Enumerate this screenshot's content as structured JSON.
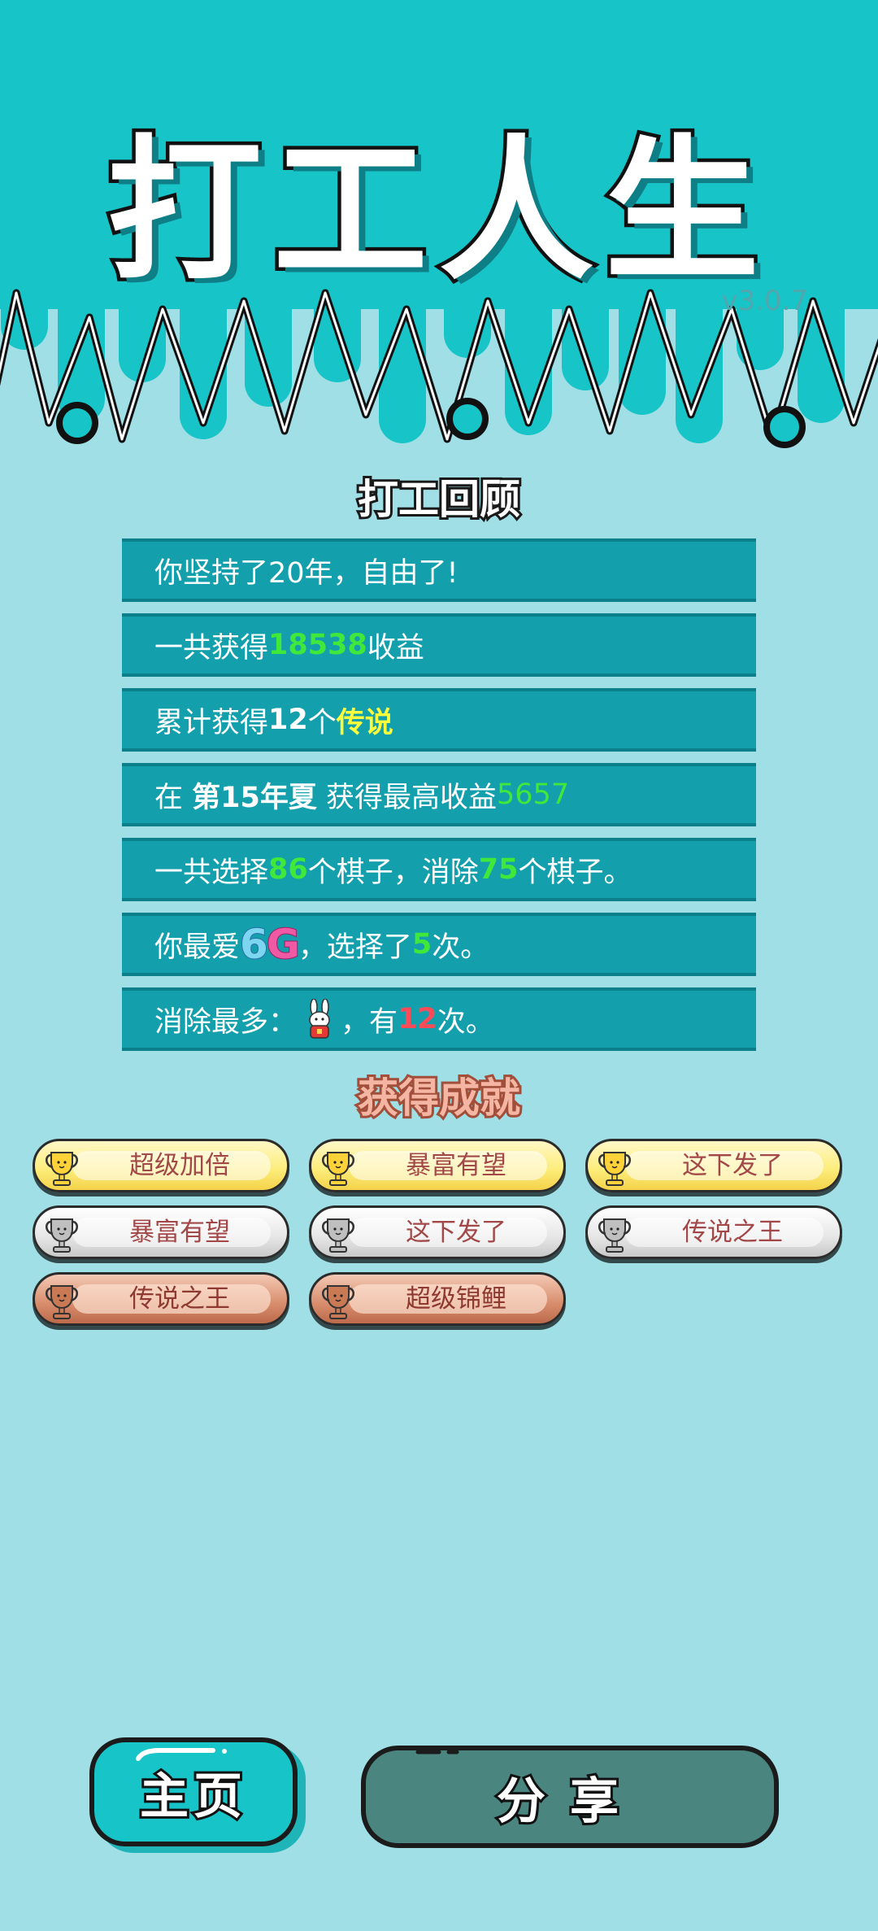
{
  "header": {
    "title": "打工人生",
    "version": "v3.0.7"
  },
  "review": {
    "title": "打工回顾",
    "row1": {
      "text": "你坚持了20年，自由了!"
    },
    "row2": {
      "pre": "一共获得",
      "value": "18538",
      "post": "收益"
    },
    "row3": {
      "pre": "累计获得",
      "count": "12",
      "mid": "个",
      "tag": "传说"
    },
    "row4": {
      "pre": "在",
      "when": "第15年夏",
      "mid": "获得最高收益",
      "value": "5657"
    },
    "row5": {
      "pre": "一共选择",
      "chosen": "86",
      "mid": "个棋子，消除",
      "removed": "75",
      "post": "个棋子。"
    },
    "row6": {
      "pre": "你最爱",
      "fav_a": "6",
      "fav_b": "G",
      "mid": "，选择了",
      "times": "5",
      "post": "次。"
    },
    "row7": {
      "pre": "消除最多：",
      "icon": "rabbit-icon",
      "mid": "，有",
      "times": "12",
      "post": "次。"
    }
  },
  "achievements": {
    "title": "获得成就",
    "items": [
      {
        "label": "超级加倍",
        "tier": "gold"
      },
      {
        "label": "暴富有望",
        "tier": "gold"
      },
      {
        "label": "这下发了",
        "tier": "gold"
      },
      {
        "label": "暴富有望",
        "tier": "silver"
      },
      {
        "label": "这下发了",
        "tier": "silver"
      },
      {
        "label": "传说之王",
        "tier": "silver"
      },
      {
        "label": "传说之王",
        "tier": "bronze"
      },
      {
        "label": "超级锦鲤",
        "tier": "bronze"
      }
    ]
  },
  "buttons": {
    "home": "主页",
    "share": "分享"
  },
  "colors": {
    "background": "#a0dfe5",
    "header": "#17c4c7",
    "row": "#149fac",
    "highlight_green": "#3fe83a",
    "highlight_yellow": "#fcff3b",
    "highlight_red": "#ff4b57",
    "share_button": "#4b8580"
  }
}
